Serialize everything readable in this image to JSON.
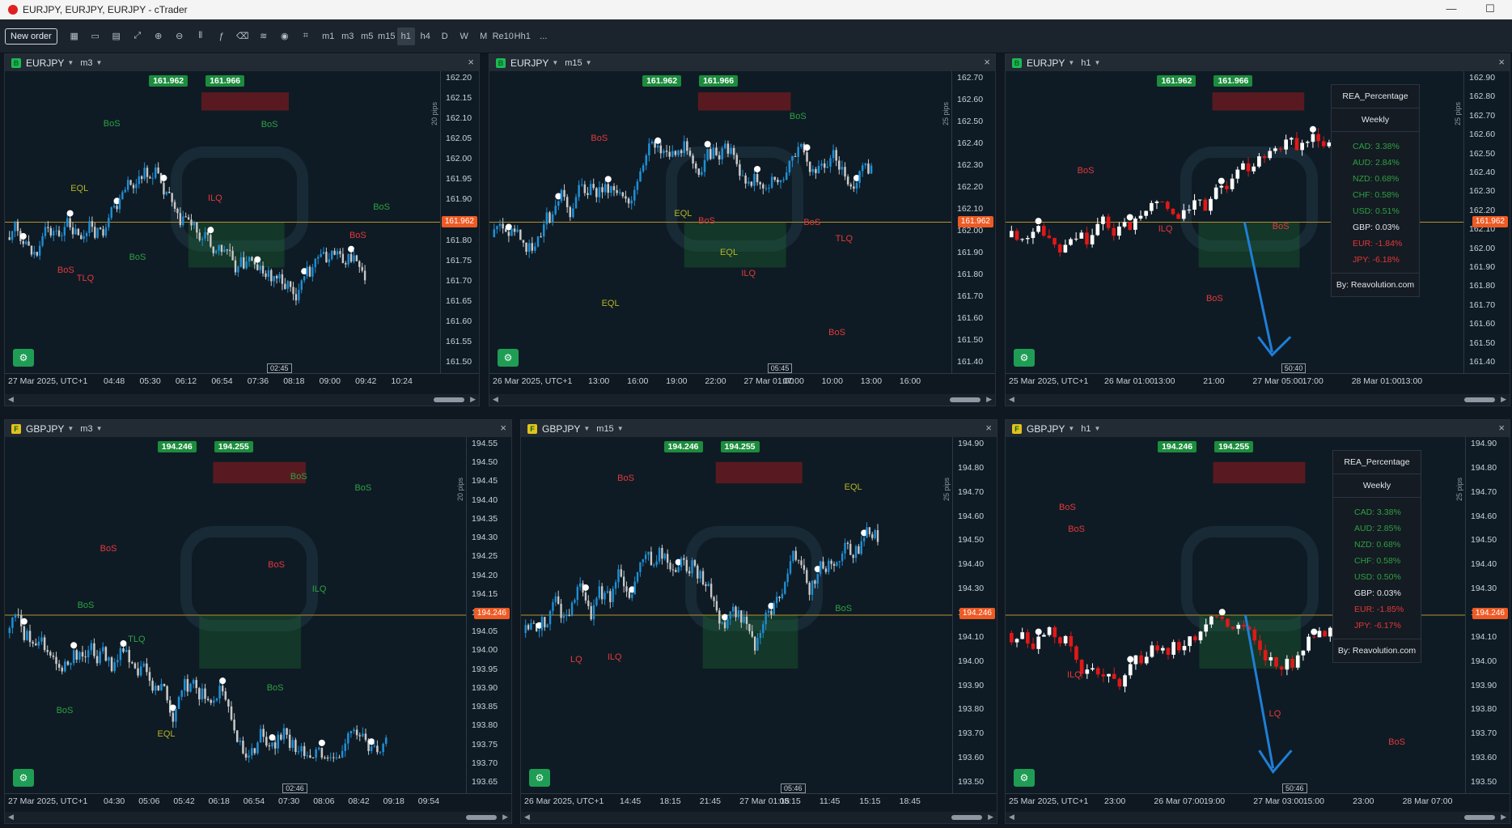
{
  "window": {
    "title": "EURJPY, EURJPY, EURJPY - cTrader",
    "minimize": "—",
    "maximize": "☐"
  },
  "toolbar": {
    "new_order_label": "New order",
    "icons": [
      "grid-layout-icon",
      "single-chart-icon",
      "split-chart-icon",
      "chart-type-icon",
      "zoom-in-icon",
      "zoom-out-icon",
      "candles-icon",
      "indicators-icon",
      "objects-icon",
      "layers-icon",
      "watch-icon",
      "templates-icon"
    ],
    "timeframes": [
      "m1",
      "m3",
      "m5",
      "m15",
      "h1",
      "h4",
      "D",
      "W",
      "M",
      "Re10",
      "Hh1"
    ],
    "active_timeframe": "h1",
    "more_label": "..."
  },
  "panels": [
    {
      "symbol": "EURJPY",
      "timeframe": "m3",
      "badge_color": "#1db954",
      "bid": "161.962",
      "ask": "161.966",
      "current": "161.962",
      "yticks": [
        "162.20",
        "162.15",
        "162.10",
        "162.05",
        "162.00",
        "161.95",
        "161.90",
        "161.85",
        "161.80",
        "161.75",
        "161.70",
        "161.65",
        "161.60",
        "161.55",
        "161.50"
      ],
      "xticks": [
        "27 Mar 2025, UTC+1",
        "04:48",
        "05:30",
        "06:12",
        "06:54",
        "07:36",
        "08:18",
        "09:00",
        "09:42",
        "10:24"
      ],
      "pips": "20 pips",
      "bar_timer": "02:45",
      "tags": [
        {
          "text": "ILQ",
          "cls": "red"
        },
        {
          "text": "TLQ",
          "cls": "red"
        },
        {
          "text": "EQL",
          "cls": "yel"
        },
        {
          "text": "BoS",
          "cls": "grn"
        },
        {
          "text": "BoS",
          "cls": "grn"
        },
        {
          "text": "BoS",
          "cls": "grn"
        },
        {
          "text": "BoS",
          "cls": "red"
        },
        {
          "text": "BoS",
          "cls": "red"
        },
        {
          "text": "BoS",
          "cls": "grn"
        }
      ]
    },
    {
      "symbol": "EURJPY",
      "timeframe": "m15",
      "badge_color": "#1db954",
      "bid": "161.962",
      "ask": "161.966",
      "current": "161.962",
      "yticks": [
        "162.70",
        "162.60",
        "162.50",
        "162.40",
        "162.30",
        "162.20",
        "162.10",
        "162.00",
        "161.90",
        "161.80",
        "161.70",
        "161.60",
        "161.50",
        "161.40"
      ],
      "xticks": [
        "26 Mar 2025, UTC+1",
        "13:00",
        "16:00",
        "19:00",
        "22:00",
        "27 Mar 01:00",
        "07:00",
        "10:00",
        "13:00",
        "16:00"
      ],
      "pips": "25 pips",
      "bar_timer": "05:45",
      "tags": [
        {
          "text": "EQL",
          "cls": "yel"
        },
        {
          "text": "EQL",
          "cls": "yel"
        },
        {
          "text": "ILQ",
          "cls": "red"
        },
        {
          "text": "TLQ",
          "cls": "red"
        },
        {
          "text": "EQL",
          "cls": "yel"
        },
        {
          "text": "BoS",
          "cls": "grn"
        },
        {
          "text": "BoS",
          "cls": "red"
        },
        {
          "text": "BoS",
          "cls": "red"
        },
        {
          "text": "BoS",
          "cls": "red"
        },
        {
          "text": "BoS",
          "cls": "red"
        }
      ]
    },
    {
      "symbol": "EURJPY",
      "timeframe": "h1",
      "badge_color": "#1db954",
      "bid": "161.962",
      "ask": "161.966",
      "current": "161.962",
      "yticks": [
        "162.90",
        "162.80",
        "162.70",
        "162.60",
        "162.50",
        "162.40",
        "162.30",
        "162.20",
        "162.10",
        "162.00",
        "161.90",
        "161.80",
        "161.70",
        "161.60",
        "161.50",
        "161.40"
      ],
      "xticks": [
        "25 Mar 2025, UTC+1",
        "26 Mar 01:00",
        "13:00",
        "21:00",
        "27 Mar 05:00",
        "17:00",
        "28 Mar 01:00",
        "13:00"
      ],
      "pips": "25 pips",
      "bar_timer": "50:40",
      "tags": [
        {
          "text": "ILQ",
          "cls": "red"
        },
        {
          "text": "BoS",
          "cls": "red"
        },
        {
          "text": "BoS",
          "cls": "red"
        },
        {
          "text": "BoS",
          "cls": "red"
        }
      ],
      "rea": {
        "title": "REA_Percentage",
        "period": "Weekly",
        "rows": [
          {
            "text": "CAD: 3.38%",
            "color": "#2ea043"
          },
          {
            "text": "AUD: 2.84%",
            "color": "#2ea043"
          },
          {
            "text": "NZD: 0.68%",
            "color": "#2ea043"
          },
          {
            "text": "CHF: 0.58%",
            "color": "#2ea043"
          },
          {
            "text": "USD: 0.51%",
            "color": "#2ea043"
          },
          {
            "text": "GBP: 0.03%",
            "color": "#e3e7eb"
          },
          {
            "text": "EUR: -1.84%",
            "color": "#e5383b"
          },
          {
            "text": "JPY: -6.18%",
            "color": "#e5383b"
          }
        ],
        "by": "By: Reavolution.com"
      }
    },
    {
      "symbol": "GBPJPY",
      "timeframe": "m3",
      "badge_color": "#e3c21b",
      "bid": "194.246",
      "ask": "194.255",
      "current": "194.246",
      "yticks": [
        "194.55",
        "194.50",
        "194.45",
        "194.40",
        "194.35",
        "194.30",
        "194.25",
        "194.20",
        "194.15",
        "194.10",
        "194.05",
        "194.00",
        "193.95",
        "193.90",
        "193.85",
        "193.80",
        "193.75",
        "193.70",
        "193.65"
      ],
      "xticks": [
        "27 Mar 2025, UTC+1",
        "04:30",
        "05:06",
        "05:42",
        "06:18",
        "06:54",
        "07:30",
        "08:06",
        "08:42",
        "09:18",
        "09:54"
      ],
      "pips": "20 pips",
      "bar_timer": "02:46",
      "tags": [
        {
          "text": "TLQ",
          "cls": "grn"
        },
        {
          "text": "ILQ",
          "cls": "grn"
        },
        {
          "text": "EQL",
          "cls": "yel"
        },
        {
          "text": "BoS",
          "cls": "grn"
        },
        {
          "text": "BoS",
          "cls": "grn"
        },
        {
          "text": "BoS",
          "cls": "grn"
        },
        {
          "text": "BoS",
          "cls": "grn"
        },
        {
          "text": "BoS",
          "cls": "grn"
        },
        {
          "text": "BoS",
          "cls": "red"
        },
        {
          "text": "BoS",
          "cls": "red"
        }
      ]
    },
    {
      "symbol": "GBPJPY",
      "timeframe": "m15",
      "badge_color": "#e3c21b",
      "bid": "194.246",
      "ask": "194.255",
      "current": "194.246",
      "yticks": [
        "194.90",
        "194.80",
        "194.70",
        "194.60",
        "194.50",
        "194.40",
        "194.30",
        "194.20",
        "194.10",
        "194.00",
        "193.90",
        "193.80",
        "193.70",
        "193.60",
        "193.50"
      ],
      "xticks": [
        "26 Mar 2025, UTC+1",
        "14:45",
        "18:15",
        "21:45",
        "27 Mar 01:15",
        "08:15",
        "11:45",
        "15:15",
        "18:45"
      ],
      "pips": "25 pips",
      "bar_timer": "05:46",
      "tags": [
        {
          "text": "ILQ",
          "cls": "red"
        },
        {
          "text": "EQL",
          "cls": "yel"
        },
        {
          "text": "BoS",
          "cls": "red"
        },
        {
          "text": "BoS",
          "cls": "grn"
        },
        {
          "text": "LQ",
          "cls": "red"
        }
      ]
    },
    {
      "symbol": "GBPJPY",
      "timeframe": "h1",
      "badge_color": "#e3c21b",
      "bid": "194.246",
      "ask": "194.255",
      "current": "194.246",
      "yticks": [
        "194.90",
        "194.80",
        "194.70",
        "194.60",
        "194.50",
        "194.40",
        "194.30",
        "194.20",
        "194.10",
        "194.00",
        "193.90",
        "193.80",
        "193.70",
        "193.60",
        "193.50"
      ],
      "xticks": [
        "25 Mar 2025, UTC+1",
        "23:00",
        "26 Mar 07:00",
        "19:00",
        "27 Mar 03:00",
        "15:00",
        "23:00",
        "28 Mar 07:00"
      ],
      "pips": "25 pips",
      "bar_timer": "50:46",
      "tags": [
        {
          "text": "ILQ",
          "cls": "red"
        },
        {
          "text": "BoS",
          "cls": "red"
        },
        {
          "text": "BoS",
          "cls": "red"
        },
        {
          "text": "BoS",
          "cls": "red"
        },
        {
          "text": "LQ",
          "cls": "red"
        }
      ],
      "rea": {
        "title": "REA_Percentage",
        "period": "Weekly",
        "rows": [
          {
            "text": "CAD: 3.38%",
            "color": "#2ea043"
          },
          {
            "text": "AUD: 2.85%",
            "color": "#2ea043"
          },
          {
            "text": "NZD: 0.68%",
            "color": "#2ea043"
          },
          {
            "text": "CHF: 0.58%",
            "color": "#2ea043"
          },
          {
            "text": "USD: 0.50%",
            "color": "#2ea043"
          },
          {
            "text": "GBP: 0.03%",
            "color": "#e3e7eb"
          },
          {
            "text": "EUR: -1.85%",
            "color": "#e5383b"
          },
          {
            "text": "JPY: -6.17%",
            "color": "#e5383b"
          }
        ],
        "by": "By: Reavolution.com"
      }
    }
  ]
}
